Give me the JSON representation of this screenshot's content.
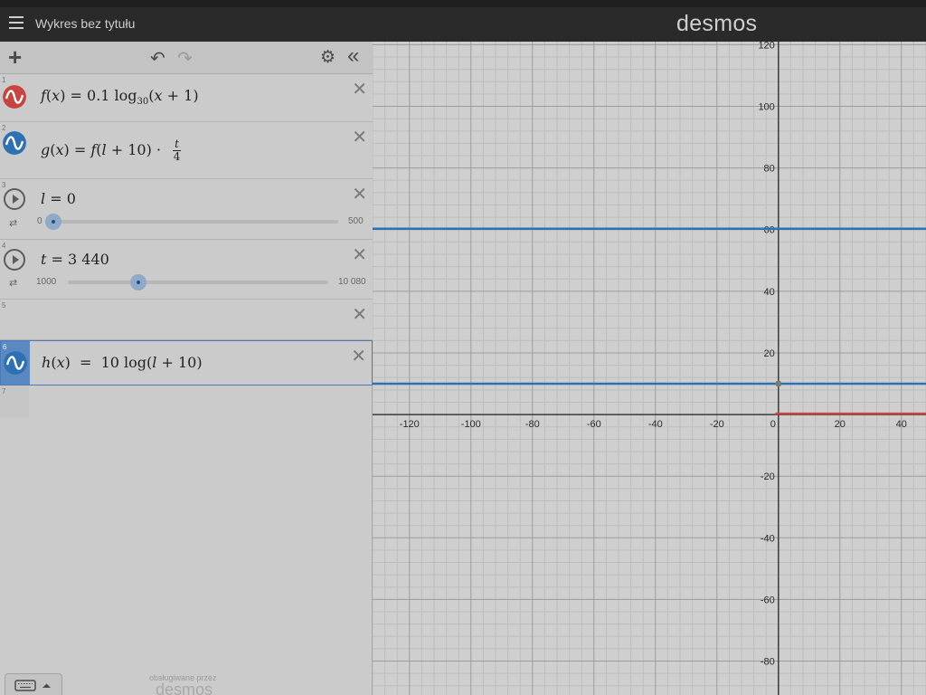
{
  "header": {
    "title": "Wykres bez tytułu",
    "brand": "desmos"
  },
  "toolbar": {
    "add_icon": "plus-icon",
    "undo_icon": "undo-icon",
    "redo_icon": "redo-icon",
    "settings_icon": "gear-icon",
    "collapse_icon": "double-chevron-left-icon"
  },
  "expressions": [
    {
      "index": "1",
      "latex_text": "f(x) = 0.1 log30(x + 1)",
      "color": "#c74440"
    },
    {
      "index": "2",
      "latex_text": "g(x) = f(l + 10) · t/4",
      "color": "#2d70b3"
    },
    {
      "index": "3",
      "name": "l",
      "value": "0",
      "min": "0",
      "max": "500",
      "fraction": 0.0
    },
    {
      "index": "4",
      "name": "t",
      "value": "3 440",
      "min": "1000",
      "max": "10 080",
      "fraction": 0.27
    },
    {
      "index": "5"
    },
    {
      "index": "6",
      "latex_text": "h(x) = 10 log(l + 10)",
      "color": "#2d70b3"
    },
    {
      "index": "7"
    }
  ],
  "footer": {
    "powered_by": "obsługiwane przez",
    "brand": "desmos"
  },
  "graph": {
    "x_ticks": [
      "-120",
      "-100",
      "-80",
      "-60",
      "-40",
      "-20",
      "0",
      "20",
      "40"
    ],
    "y_ticks": [
      "120",
      "100",
      "80",
      "60",
      "40",
      "20",
      "-20",
      "-40",
      "-60",
      "-80"
    ],
    "xlim": [
      -132,
      48
    ],
    "ylim": [
      -91,
      121
    ],
    "curves": [
      {
        "name": "g",
        "y": 60.3,
        "color": "#2d70b3"
      },
      {
        "name": "h",
        "y": 10,
        "color": "#2d70b3"
      },
      {
        "name": "f",
        "y": 0.3,
        "x_start": -1,
        "color": "#c74440"
      }
    ],
    "point": {
      "x": 0,
      "y": 10
    }
  }
}
